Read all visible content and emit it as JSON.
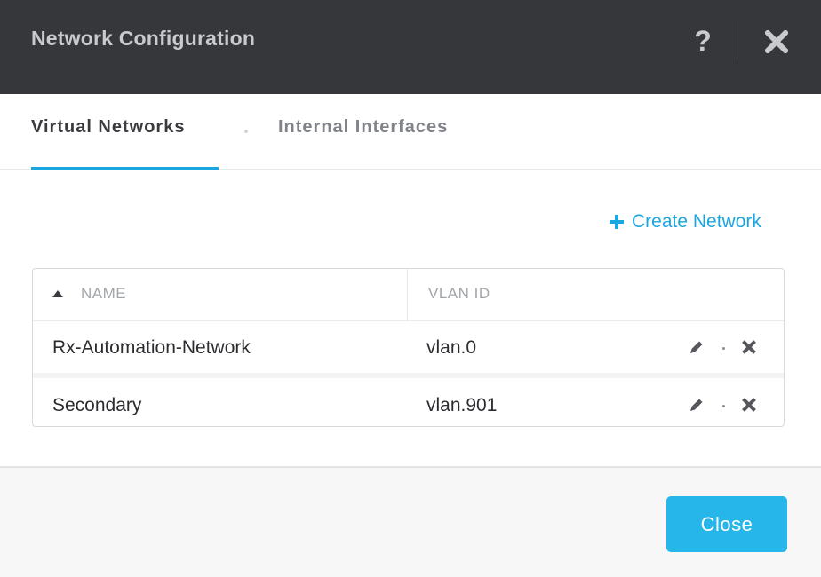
{
  "dialog": {
    "title": "Network Configuration",
    "help_label": "?"
  },
  "tabs": [
    {
      "label": "Virtual Networks",
      "active": true
    },
    {
      "label": "Internal Interfaces",
      "active": false
    }
  ],
  "actions": {
    "create_label": "Create Network"
  },
  "table": {
    "columns": [
      "NAME",
      "VLAN ID"
    ],
    "sort": {
      "column": "NAME",
      "direction": "ascending"
    },
    "rows": [
      {
        "name": "Rx-Automation-Network",
        "vlan": "vlan.0"
      },
      {
        "name": "Secondary",
        "vlan": "vlan.901"
      }
    ]
  },
  "footer": {
    "close_label": "Close"
  },
  "colors": {
    "header_bg": "#35373b",
    "accent": "#1aa7e0",
    "button": "#27b6ea"
  },
  "icons": [
    "help-icon",
    "close-icon",
    "plus-icon",
    "sort-ascending-icon",
    "pencil-icon",
    "delete-x-icon"
  ]
}
